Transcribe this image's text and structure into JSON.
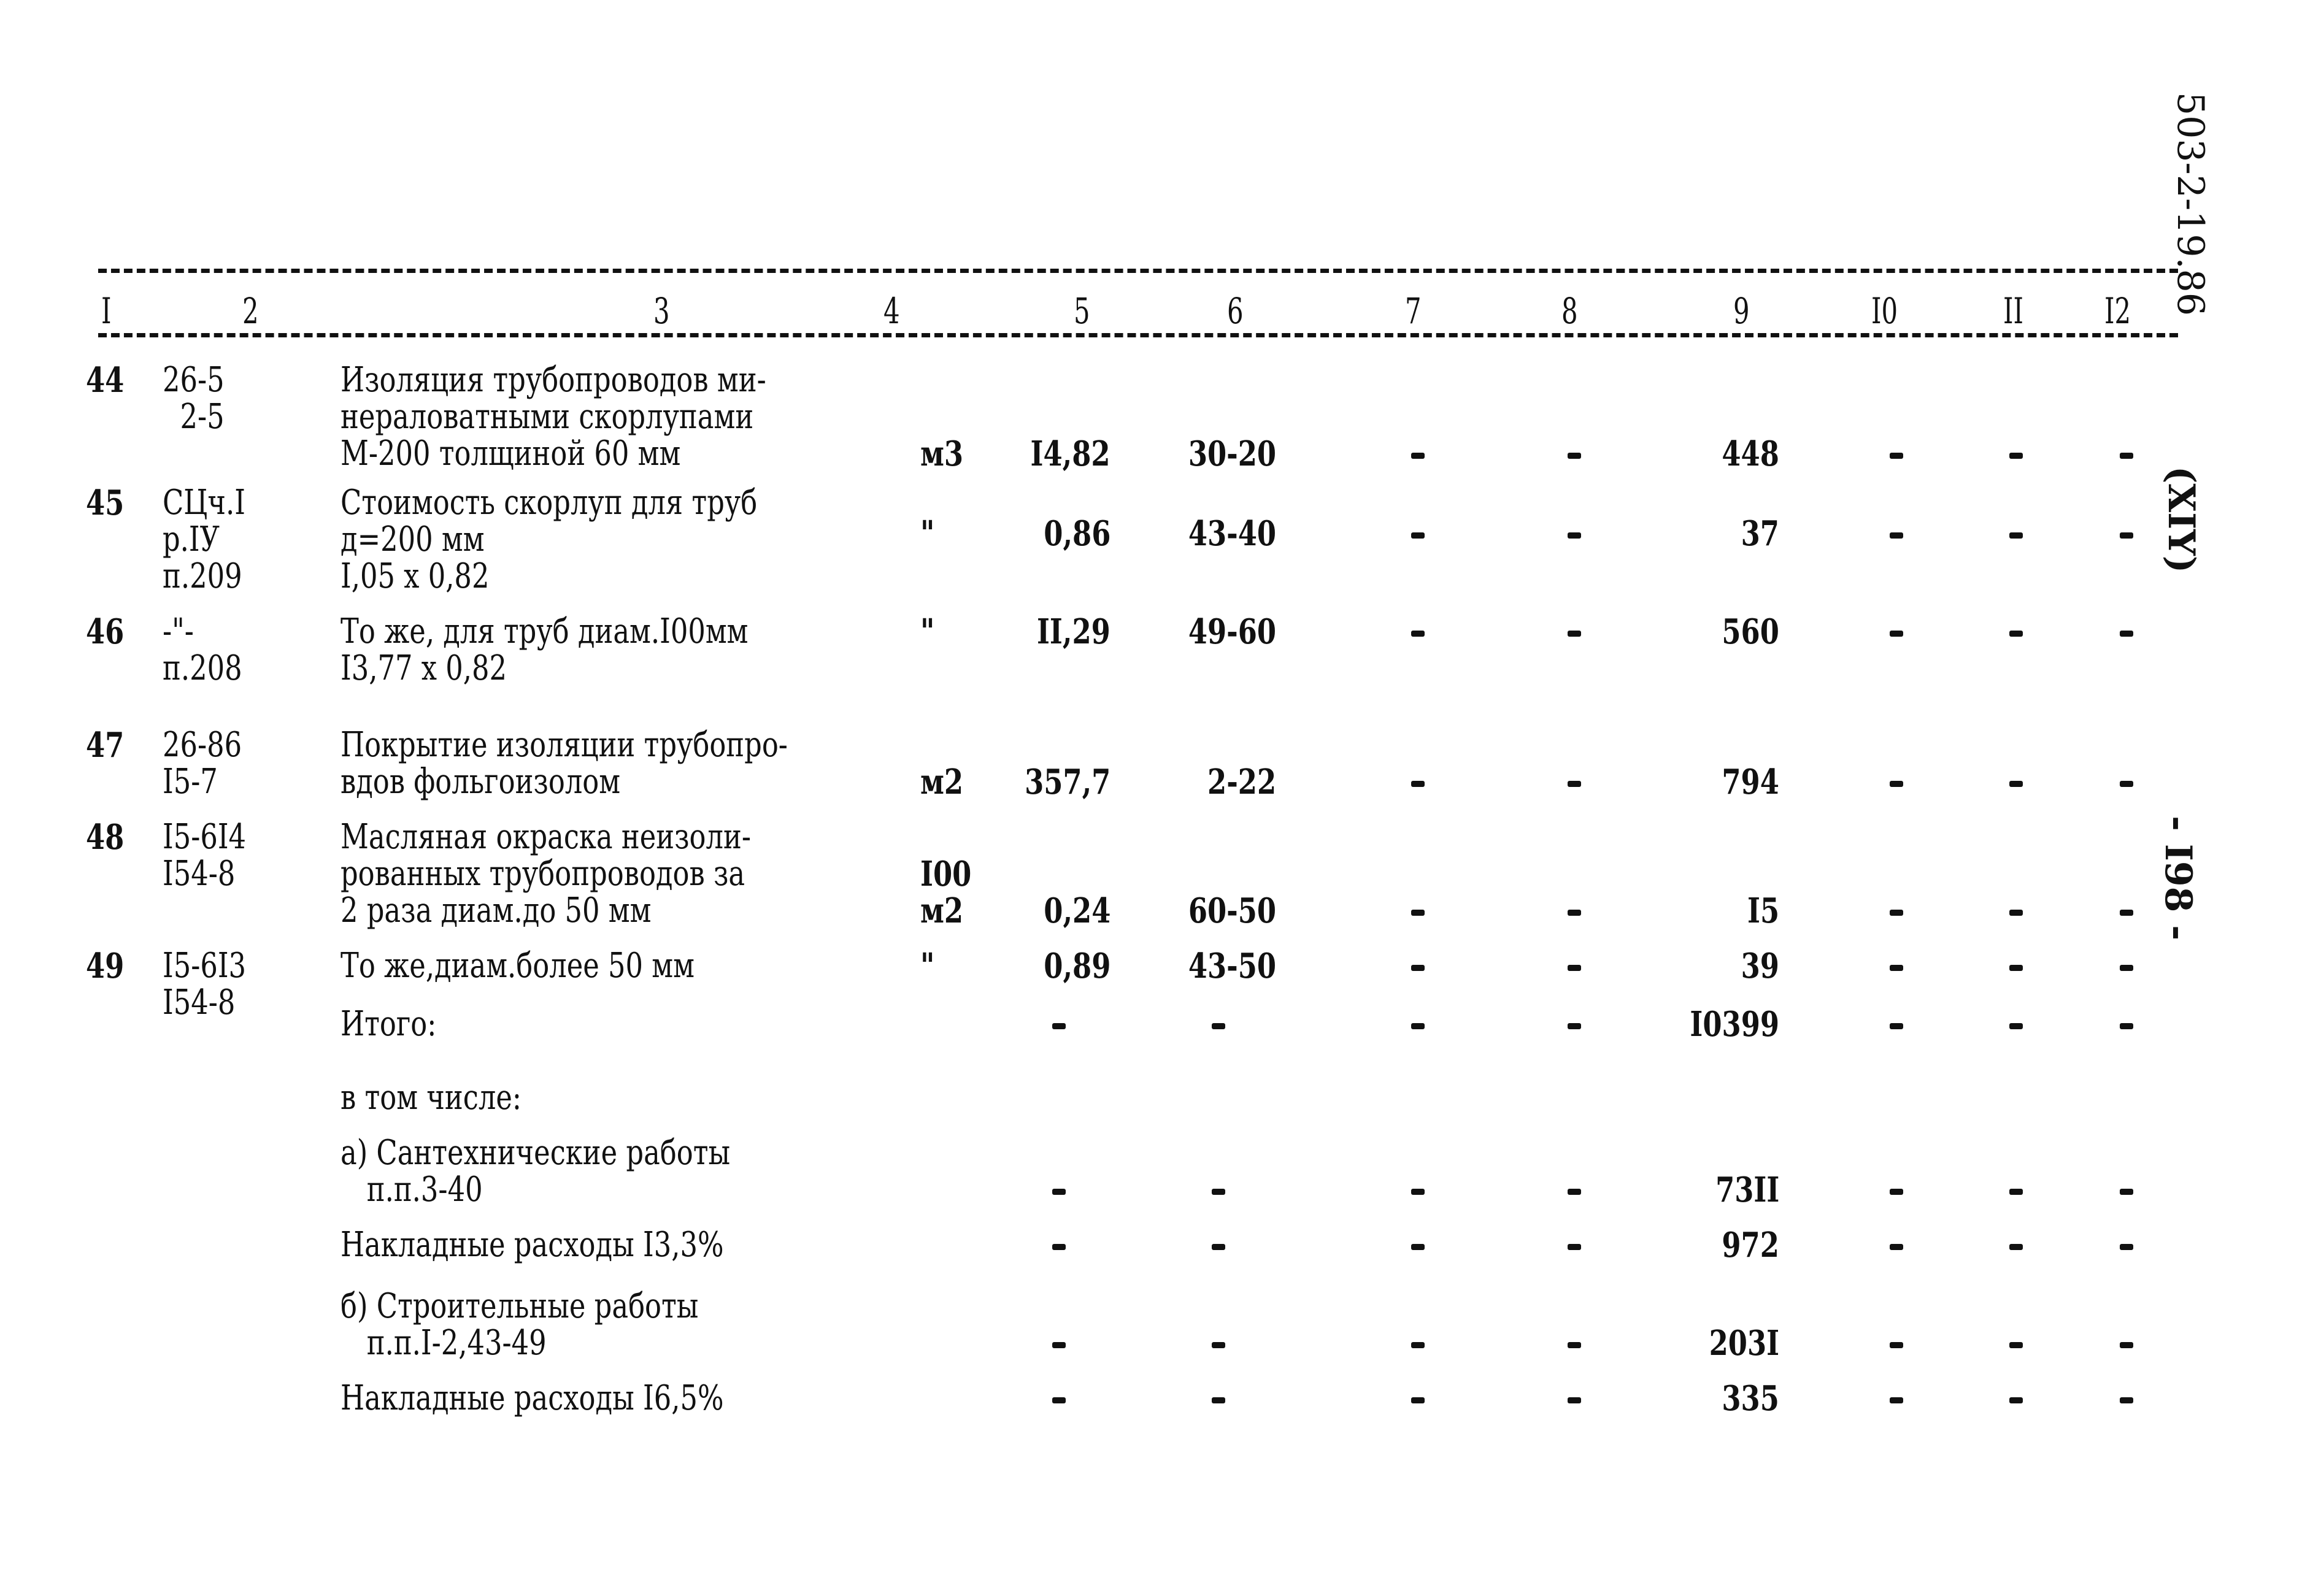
{
  "document": {
    "side_labels": {
      "doc_code": "503-2-19.86",
      "album": "(XIY)",
      "page": "- I98 -"
    },
    "column_headers": [
      "I",
      "2",
      "3",
      "4",
      "5",
      "6",
      "7",
      "8",
      "9",
      "I0",
      "II",
      "I2"
    ],
    "rows": [
      {
        "n": "44",
        "ref": "26-5\n  2-5",
        "desc": "Изоляция трубопроводов ми-\nнераловатными скорлупами\nМ-200 толщиной 60 мм",
        "unit": "м3",
        "qty": "I4,82",
        "price": "30-20",
        "c7": "-",
        "c8": "-",
        "total": "448",
        "c10": "-",
        "c11": "-",
        "c12": "-"
      },
      {
        "n": "45",
        "ref": "СЦч.I\nр.IУ\nп.209",
        "desc": "Стоимость скорлуп для труб\nд=200 мм\nI,05 x 0,82",
        "unit": "\"",
        "qty": "0,86",
        "price": "43-40",
        "c7": "-",
        "c8": "-",
        "total": "37",
        "c10": "-",
        "c11": "-",
        "c12": "-"
      },
      {
        "n": "46",
        "ref": "-\"-\nп.208",
        "desc": "То же, для труб диам.I00мм\nI3,77 x 0,82",
        "unit": "\"",
        "qty": "II,29",
        "price": "49-60",
        "c7": "-",
        "c8": "-",
        "total": "560",
        "c10": "-",
        "c11": "-",
        "c12": "-"
      },
      {
        "n": "47",
        "ref": "26-86\nI5-7",
        "desc": "Покрытие изоляции трубопро-\nвдов фольгоизолом",
        "unit": "м2",
        "qty": "357,7",
        "price": "2-22",
        "c7": "-",
        "c8": "-",
        "total": "794",
        "c10": "-",
        "c11": "-",
        "c12": "-"
      },
      {
        "n": "48",
        "ref": "I5-6I4\nI54-8",
        "desc": "Масляная окраска неизоли-\nрованных трубопроводов за\n2 раза диам.до 50 мм",
        "unit": "I00\nм2",
        "qty": "0,24",
        "price": "60-50",
        "c7": "-",
        "c8": "-",
        "total": "I5",
        "c10": "-",
        "c11": "-",
        "c12": "-"
      },
      {
        "n": "49",
        "ref": "I5-6I3\nI54-8",
        "desc": "То же,диам.более 50 мм",
        "unit": "\"",
        "qty": "0,89",
        "price": "43-50",
        "c7": "-",
        "c8": "-",
        "total": "39",
        "c10": "-",
        "c11": "-",
        "c12": "-"
      }
    ],
    "summary": [
      {
        "label": "Итого:",
        "c5": "-",
        "c6": "-",
        "c7": "-",
        "c8": "-",
        "total": "I0399",
        "c10": "-",
        "c11": "-",
        "c12": "-"
      },
      {
        "label": "в том числе:"
      },
      {
        "label": "а) Сантехнические работы\n   п.п.3-40",
        "c5": "-",
        "c6": "-",
        "c7": "-",
        "c8": "-",
        "total": "73II",
        "c10": "-",
        "c11": "-",
        "c12": "-"
      },
      {
        "label": "Накладные расходы I3,3%",
        "c5": "-",
        "c6": "-",
        "c7": "-",
        "c8": "-",
        "total": "972",
        "c10": "-",
        "c11": "-",
        "c12": "-"
      },
      {
        "label": "б) Строительные работы\n   п.п.I-2,43-49",
        "c5": "-",
        "c6": "-",
        "c7": "-",
        "c8": "-",
        "total": "203I",
        "c10": "-",
        "c11": "-",
        "c12": "-"
      },
      {
        "label": "Накладные расходы I6,5%",
        "c5": "-",
        "c6": "-",
        "c7": "-",
        "c8": "-",
        "total": "335",
        "c10": "-",
        "c11": "-",
        "c12": "-"
      }
    ]
  }
}
